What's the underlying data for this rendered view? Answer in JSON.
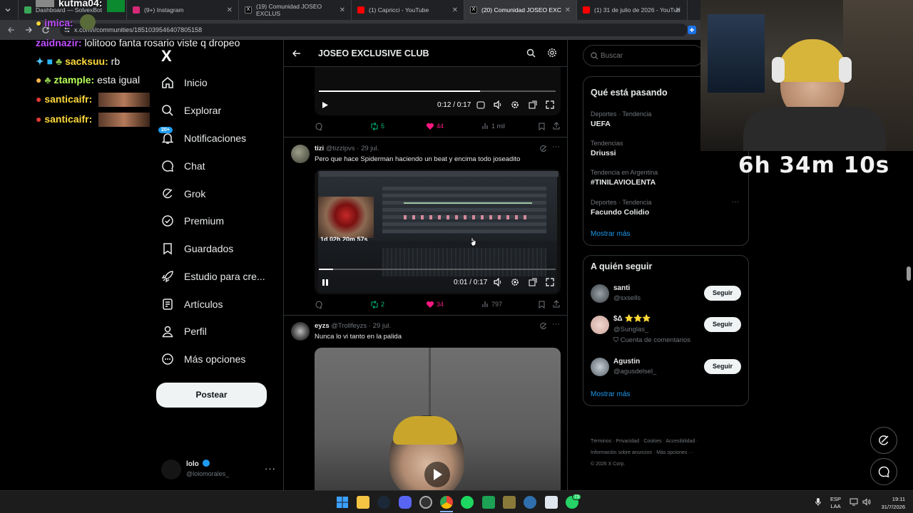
{
  "browser": {
    "tabs": [
      {
        "title": "Dashboard — SolvexBot",
        "color": "#3aa757"
      },
      {
        "title": "(9+) Instagram",
        "color": "#d62976"
      },
      {
        "title": "(19) Comunidad JOSEO EXCLUS",
        "color": "#000000"
      },
      {
        "title": "(1) Capricci - YouTube",
        "color": "#ff0000"
      },
      {
        "title": "(20) Comunidad JOSEO EXC",
        "color": "#000000"
      },
      {
        "title": "(1) 31 de julio de 2026 - YouTub",
        "color": "#ff0000"
      }
    ],
    "url": "x.com/i/communities/1851039546407805158"
  },
  "chat": [
    {
      "name": "kutma04:",
      "name_color": "#ffffff",
      "msg": ""
    },
    {
      "name": "imica:",
      "name_color": "#c04fff",
      "msg": ""
    },
    {
      "name": "zaidnazir:",
      "name_color": "#c04fff",
      "msg": " lolitooo fanta rosario viste q dropeo"
    },
    {
      "name": "sacksuu:",
      "name_color": "#ffd93b",
      "msg": " rb"
    },
    {
      "name": "ztample:",
      "name_color": "#b7ff5a",
      "msg": " esta igual"
    },
    {
      "name": "santicaifr:",
      "name_color": "#ffd93b",
      "msg": ""
    },
    {
      "name": "santicaifr:",
      "name_color": "#ffd93b",
      "msg": ""
    }
  ],
  "nav": {
    "logo": "X",
    "items": [
      {
        "label": "Inicio",
        "icon": "home-icon"
      },
      {
        "label": "Explorar",
        "icon": "search-icon"
      },
      {
        "label": "Notificaciones",
        "icon": "bell-icon",
        "badge": "20+"
      },
      {
        "label": "Chat",
        "icon": "chat-icon"
      },
      {
        "label": "Grok",
        "icon": "grok-icon"
      },
      {
        "label": "Premium",
        "icon": "verified-icon"
      },
      {
        "label": "Guardados",
        "icon": "bookmark-icon"
      },
      {
        "label": "Estudio para cre...",
        "icon": "rocket-icon"
      },
      {
        "label": "Artículos",
        "icon": "article-icon"
      },
      {
        "label": "Perfil",
        "icon": "person-icon"
      },
      {
        "label": "Más opciones",
        "icon": "more-circle-icon"
      }
    ],
    "post_button": "Postear",
    "account": {
      "name": "lolo",
      "handle": "@lolomorales_"
    }
  },
  "header": {
    "title": "JOSEO EXCLUSIVE CLUB"
  },
  "posts": [
    {
      "video_time": "0:12 / 0:17",
      "progress": 0.68,
      "retweets": "5",
      "likes": "44",
      "views": "1 mil"
    },
    {
      "author": "tizi",
      "handle": "@tizzlpvs",
      "date": "· 29 jul.",
      "text": "Pero que hace Spiderman haciendo un beat y encima todo joseadito",
      "overlay_timer": "1d 02h 20m 57s",
      "video_time": "0:01 / 0:17",
      "progress": 0.06,
      "retweets": "2",
      "likes": "34",
      "views": "797"
    },
    {
      "author": "eyzs",
      "handle": "@Trollfeyzs",
      "date": "· 29 jul.",
      "text": "Nunca lo vi tanto en la palida"
    }
  ],
  "right": {
    "search_placeholder": "Buscar",
    "trends_title": "Qué está pasando",
    "trends": [
      {
        "meta": "Deportes · Tendencia",
        "name": "UEFA"
      },
      {
        "meta": "Tendencias",
        "name": "Driussi"
      },
      {
        "meta": "Tendencia en Argentina",
        "name": "#TINILAVIOLENTA"
      },
      {
        "meta": "Deportes · Tendencia",
        "name": "Facundo Colidio"
      }
    ],
    "show_more": "Mostrar más",
    "follow_title": "A quién seguir",
    "follow": [
      {
        "name": "santi",
        "handle": "@sxsells",
        "extra": ""
      },
      {
        "name": "$Δ ⭐⭐⭐",
        "handle": "@Sunglas_",
        "extra": "Cuenta de comentarios"
      },
      {
        "name": "Agustin",
        "handle": "@agusdelsel_",
        "extra": ""
      }
    ],
    "follow_button": "Seguir",
    "footer_line1": [
      "Términos",
      "Privacidad",
      "Cookies",
      "Accesibilidad"
    ],
    "footer_line2": [
      "Información sobre anuncios",
      "Más opciones ···"
    ],
    "copyright": "© 2026 X Corp."
  },
  "stream": {
    "timer": "6h 34m 10s"
  },
  "taskbar": {
    "lang": "ESP",
    "lang2": "LAA",
    "time": "19:11",
    "date": "31/7/2026",
    "whatsapp_badge": "73"
  },
  "colors": {
    "accent": "#1d9bf0",
    "like": "#f91880",
    "retweet": "#00ba7c"
  }
}
